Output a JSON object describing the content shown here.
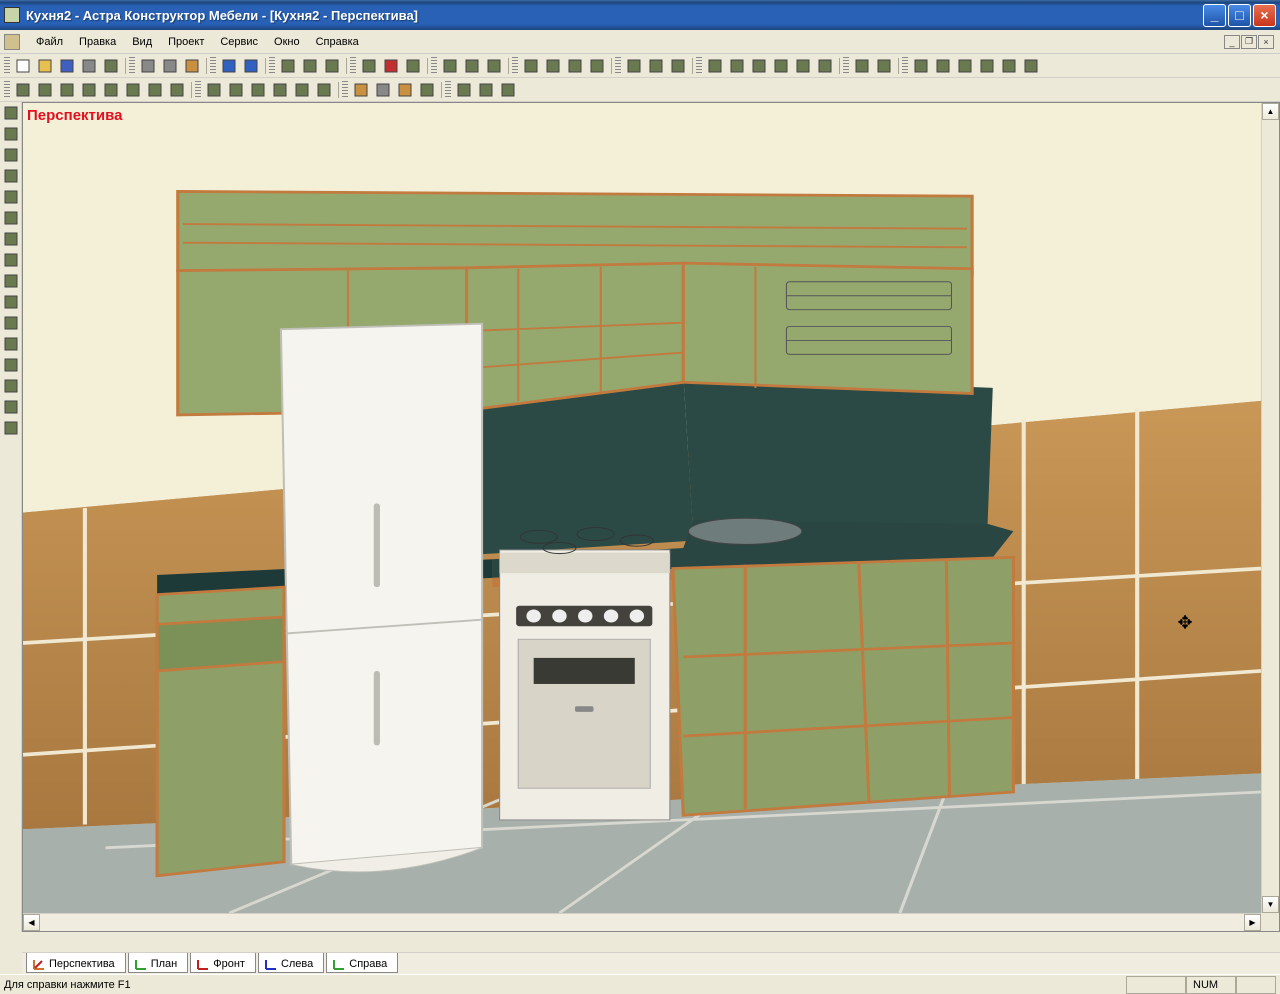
{
  "window": {
    "title": "Кухня2 - Астра Конструктор Мебели - [Кухня2 - Перспектива]"
  },
  "menu": {
    "items": [
      "Файл",
      "Правка",
      "Вид",
      "Проект",
      "Сервис",
      "Окно",
      "Справка"
    ]
  },
  "toolbar1": {
    "icons": [
      "new",
      "open",
      "save",
      "print",
      "print-preview",
      "cut",
      "copy",
      "paste",
      "undo",
      "redo",
      "grid",
      "layer",
      "filter",
      "edit-fill",
      "pin",
      "pin-rotate",
      "hierarchy",
      "select-all",
      "props",
      "zoom-in",
      "zoom-out",
      "zoom-fit",
      "orbit",
      "center",
      "wireframe",
      "window-single",
      "window-3d",
      "window-shade",
      "window-tex",
      "box-green",
      "box-brown",
      "pictogram",
      "axes",
      "panel-1",
      "panel-2",
      "panel-3",
      "panel-4",
      "panel-5",
      "split-v",
      "split-h"
    ]
  },
  "toolbar2": {
    "icons": [
      "align-l",
      "align-c",
      "align-r",
      "dist-h",
      "dist-v",
      "flip-h",
      "flip-v",
      "center-obj",
      "drop-down-1",
      "drop-down-2",
      "point-tool",
      "line-tool",
      "grid-snap",
      "dim-tool",
      "cube",
      "cylinder",
      "cone",
      "custom",
      "text-tool",
      "arrow-tool",
      "material"
    ]
  },
  "leftToolbar": {
    "icons": [
      "pointer",
      "edit",
      "rotate",
      "cabinet",
      "rect",
      "poly",
      "line",
      "scissors",
      "measure",
      "tape",
      "ruler",
      "protractor",
      "curve-cw",
      "curve-ccw",
      "box-align",
      "snap"
    ]
  },
  "viewport": {
    "label": "Перспектива"
  },
  "tabs": [
    {
      "label": "Перспектива",
      "color": "#d07030"
    },
    {
      "label": "План",
      "color": "#30a030"
    },
    {
      "label": "Фронт",
      "color": "#c02020"
    },
    {
      "label": "Слева",
      "color": "#2030c0"
    },
    {
      "label": "Справа",
      "color": "#30a030"
    }
  ],
  "statusbar": {
    "help": "Для справки нажмите F1",
    "num": "NUM"
  }
}
